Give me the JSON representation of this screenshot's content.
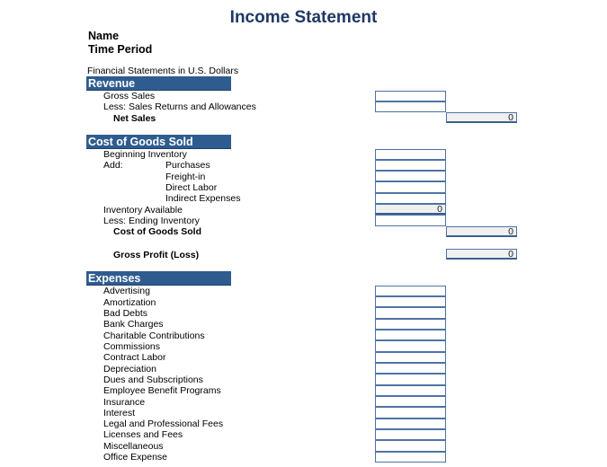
{
  "title": "Income Statement",
  "name_label": "Name",
  "period_label": "Time Period",
  "currency_note": "Financial Statements in U.S. Dollars",
  "colors": {
    "header_bg": "#2f5c8f",
    "title": "#1f3864",
    "cell_border": "#4f73a4",
    "total_bg": "#f0f0f0"
  },
  "revenue": {
    "header": "Revenue",
    "gross_sales": "Gross Sales",
    "returns": "Less: Sales Returns and Allowances",
    "net_sales_label": "Net Sales",
    "net_sales_value": "0"
  },
  "cogs": {
    "header": "Cost of Goods Sold",
    "beginning_inventory": "Beginning Inventory",
    "add_label": "Add:",
    "purchases": "Purchases",
    "freight_in": "Freight-in",
    "direct_labor": "Direct Labor",
    "indirect_expenses": "Indirect Expenses",
    "inventory_available_label": "Inventory Available",
    "inventory_available_value": "0",
    "ending_inventory": "Less: Ending Inventory",
    "cogs_total_label": "Cost of Goods Sold",
    "cogs_total_value": "0"
  },
  "gross_profit": {
    "label": "Gross Profit (Loss)",
    "value": "0"
  },
  "expenses": {
    "header": "Expenses",
    "items": [
      "Advertising",
      "Amortization",
      "Bad Debts",
      "Bank Charges",
      "Charitable Contributions",
      "Commissions",
      "Contract Labor",
      "Depreciation",
      "Dues and Subscriptions",
      "Employee Benefit Programs",
      "Insurance",
      "Interest",
      "Legal and Professional Fees",
      "Licenses and Fees",
      "Miscellaneous",
      "Office Expense"
    ]
  }
}
